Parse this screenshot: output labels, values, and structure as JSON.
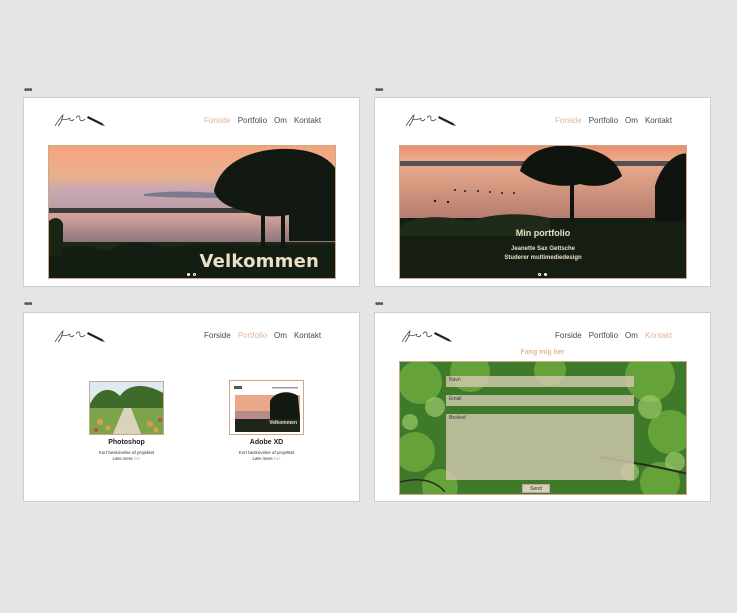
{
  "nav": [
    "Forside",
    "Portfolio",
    "Om",
    "Kontakt"
  ],
  "boards": {
    "forside": {
      "active": "Forside",
      "hero_text": "Velkommen"
    },
    "portfolio_slider": {
      "active": "Forside",
      "title": "Min portfolio",
      "subtitle_line1": "Jeanette Sax Gettsche",
      "subtitle_line2": "Studerer multimediedesign"
    },
    "portfolio": {
      "active": "Portfolio",
      "cards": [
        {
          "title": "Photoshop",
          "desc": "Kort beskrivelse af projektet",
          "more_label": "Læs mere",
          "more_link": "her"
        },
        {
          "title": "Adobe XD",
          "desc": "Kort beskrivelse af projektet",
          "more_label": "Læs mere",
          "more_link": "her",
          "thumb_text": "Velkommen"
        }
      ]
    },
    "kontakt": {
      "active": "Kontakt",
      "heading": "Fang mig her",
      "fields": {
        "name": "Navn",
        "email": "Email",
        "message": "Besked"
      },
      "send": "Send"
    }
  },
  "colors": {
    "accent": "#e0b79a",
    "hero_text": "#eadfc7",
    "background": "#e5e5e5"
  }
}
